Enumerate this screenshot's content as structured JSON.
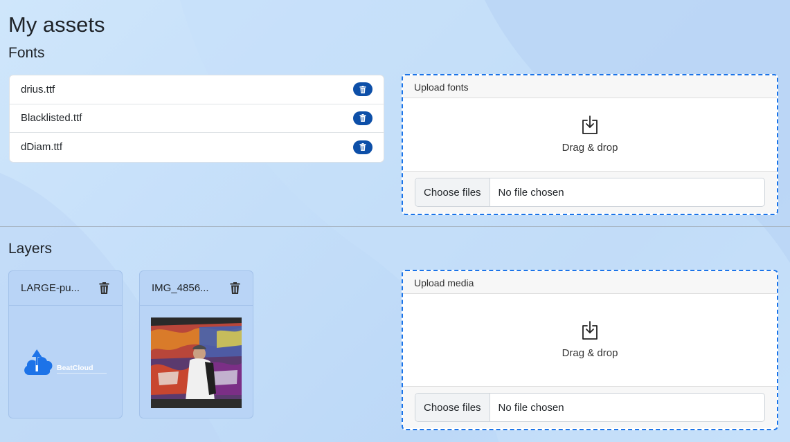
{
  "page": {
    "title": "My assets"
  },
  "fonts": {
    "section_title": "Fonts",
    "items": [
      {
        "name": "drius.ttf",
        "action_icon": "trash-icon"
      },
      {
        "name": "Blacklisted.ttf",
        "action_icon": "trash-icon"
      },
      {
        "name": "dDiam.ttf",
        "action_icon": "trash-icon"
      }
    ],
    "upload": {
      "header": "Upload fonts",
      "drop_label": "Drag & drop",
      "button_label": "Choose files",
      "status": "No file chosen"
    }
  },
  "layers": {
    "section_title": "Layers",
    "items": [
      {
        "name": "LARGE-pu...",
        "thumbnail": "beatcloud-logo",
        "logo_text": "BeatCloud"
      },
      {
        "name": "IMG_4856...",
        "thumbnail": "graffiti-photo"
      }
    ],
    "upload": {
      "header": "Upload media",
      "drop_label": "Drag & drop",
      "button_label": "Choose files",
      "status": "No file chosen"
    }
  },
  "colors": {
    "accent": "#1a73e8",
    "trash_pill": "#0d4fa8",
    "logo_blue": "#1d73e8"
  }
}
